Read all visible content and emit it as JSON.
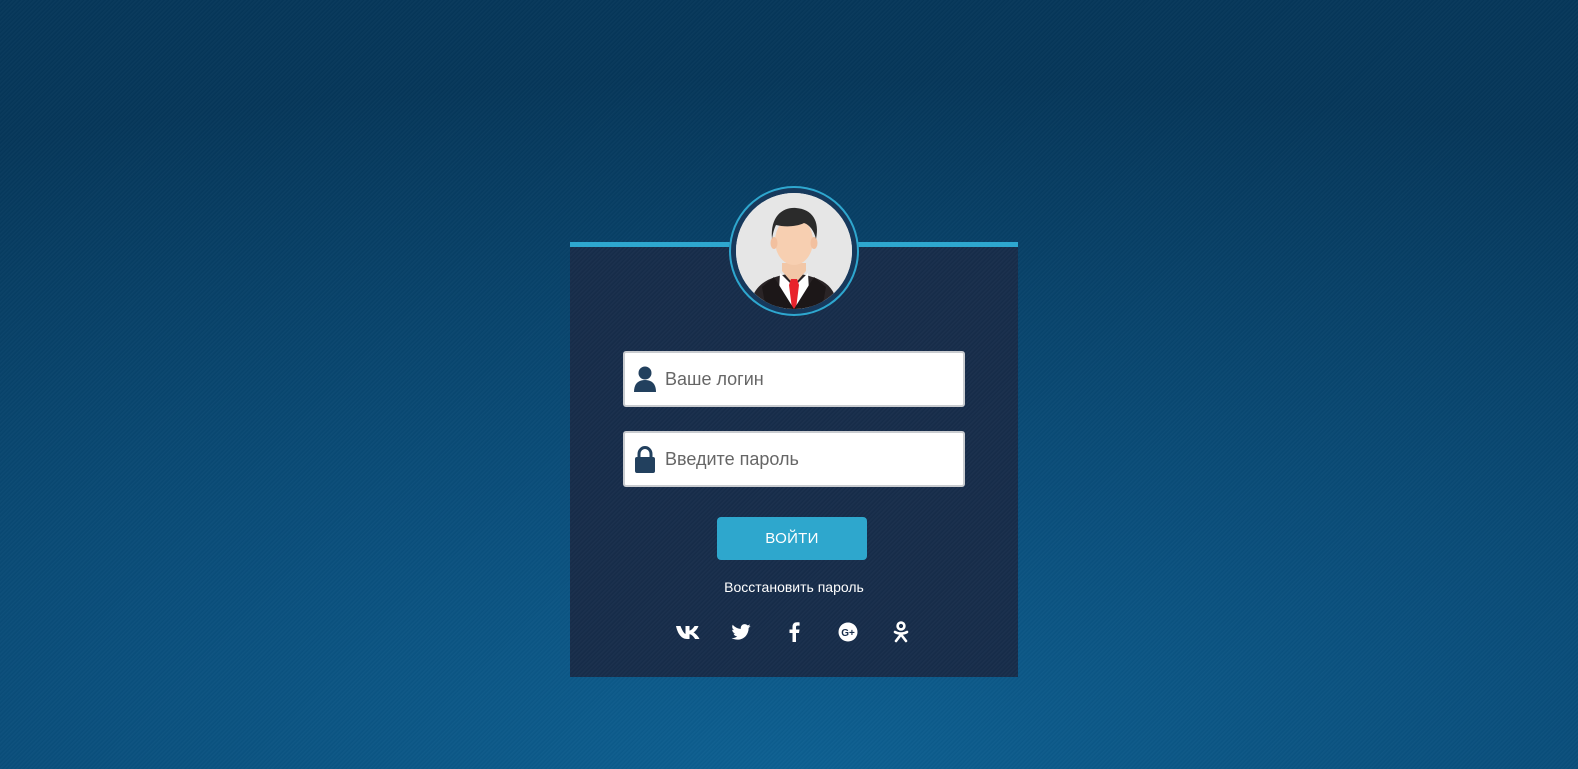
{
  "colors": {
    "accent": "#2ea7cf",
    "card_background": "#172d4b",
    "page_background": "#0a4f7c",
    "icon_dark": "#22405e"
  },
  "login_form": {
    "login_placeholder": "Ваше логин",
    "password_placeholder": "Введите пароль",
    "submit_label": "ВОЙТИ",
    "restore_password_label": "Восстановить пароль"
  },
  "icons": {
    "avatar": "user-avatar-businessman",
    "login_field": "user-icon",
    "password_field": "lock-icon"
  },
  "social_links": [
    {
      "name": "vk-icon"
    },
    {
      "name": "twitter-icon"
    },
    {
      "name": "facebook-icon"
    },
    {
      "name": "google-plus-icon"
    },
    {
      "name": "odnoklassniki-icon"
    }
  ]
}
